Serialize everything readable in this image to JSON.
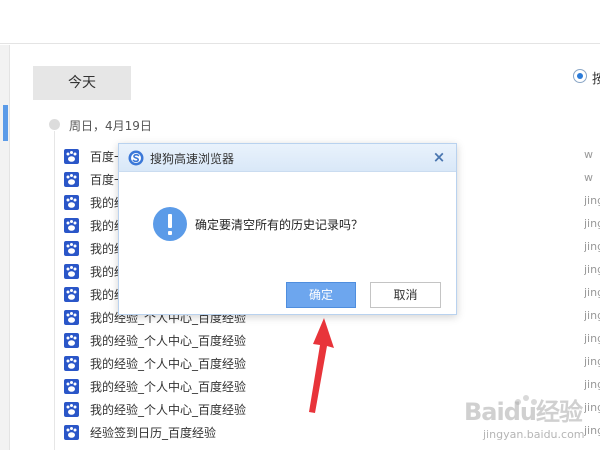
{
  "sidebar": {
    "tab_today": "今天"
  },
  "history": {
    "date_header": "周日，4月19日",
    "radio_label": "按",
    "rows": [
      {
        "title": "百度一",
        "url": "w"
      },
      {
        "title": "百度一",
        "url": "w"
      },
      {
        "title": "我的经",
        "url": "jing"
      },
      {
        "title": "我的经",
        "url": "jing"
      },
      {
        "title": "我的经",
        "url": "jing"
      },
      {
        "title": "我的经_个人中心_百度经验",
        "url": "jing"
      },
      {
        "title": "我的经_个人中心_百度经验",
        "url": "jing"
      },
      {
        "title": "我的经验_个人中心_百度经验",
        "url": "jing"
      },
      {
        "title": "我的经验_个人中心_百度经验",
        "url": "jing"
      },
      {
        "title": "我的经验_个人中心_百度经验",
        "url": "jing"
      },
      {
        "title": "我的经验_个人中心_百度经验",
        "url": "jing"
      },
      {
        "title": "我的经验_个人中心_百度经验",
        "url": "jing"
      },
      {
        "title": "经验签到日历_百度经验",
        "url": "jing"
      }
    ]
  },
  "dialog": {
    "title": "搜狗高速浏览器",
    "close_glyph": "×",
    "message": "确定要清空所有的历史记录吗？",
    "confirm_label": "确定",
    "cancel_label": "取消"
  },
  "watermark": {
    "text": "Baidu经验",
    "sub": "jingyan.baidu.com"
  },
  "icons": {
    "favicon": "baidu-paw-icon",
    "alert": "exclamation-icon",
    "dialog_logo": "sogou-browser-logo-icon"
  },
  "colors": {
    "accent": "#5b9be8",
    "confirm_button": "#6da6ee",
    "favicon_bg": "#2a56c8",
    "arrow": "#e8343a"
  }
}
